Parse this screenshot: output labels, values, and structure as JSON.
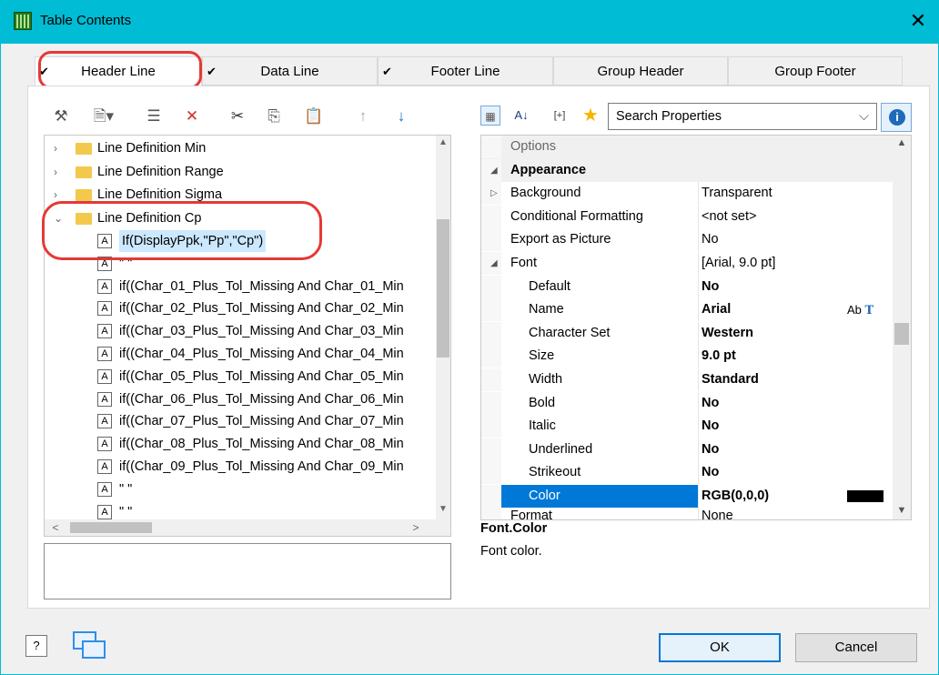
{
  "window": {
    "title": "Table Contents",
    "close_glyph": "✕"
  },
  "tabs": [
    {
      "label": "Header Line",
      "checked": true,
      "active": true
    },
    {
      "label": "Data Line",
      "checked": true,
      "active": false
    },
    {
      "label": "Footer Line",
      "checked": true,
      "active": false
    },
    {
      "label": "Group Header",
      "checked": false,
      "active": false
    },
    {
      "label": "Group Footer",
      "checked": false,
      "active": false
    }
  ],
  "tree_toolbar": {
    "icons": [
      "wand-icon",
      "new-item-dropdown-icon",
      "properties-icon",
      "delete-icon",
      "cut-icon",
      "copy-icon",
      "paste-icon",
      "move-up-icon",
      "move-down-icon"
    ]
  },
  "tree": {
    "folders": [
      {
        "label": "Line Definition Min",
        "expanded": false
      },
      {
        "label": "Line Definition Range",
        "expanded": false
      },
      {
        "label": "Line Definition Sigma",
        "expanded": false
      },
      {
        "label": "Line Definition Cp",
        "expanded": true
      }
    ],
    "items": [
      {
        "label": "If(DisplayPpk,\"Pp\",\"Cp\")",
        "selected": true
      },
      {
        "label": "\" \"",
        "selected": false
      },
      {
        "label": "if((Char_01_Plus_Tol_Missing And Char_01_Min",
        "selected": false
      },
      {
        "label": "if((Char_02_Plus_Tol_Missing And Char_02_Min",
        "selected": false
      },
      {
        "label": "if((Char_03_Plus_Tol_Missing And Char_03_Min",
        "selected": false
      },
      {
        "label": "if((Char_04_Plus_Tol_Missing And Char_04_Min",
        "selected": false
      },
      {
        "label": "if((Char_05_Plus_Tol_Missing And Char_05_Min",
        "selected": false
      },
      {
        "label": "if((Char_06_Plus_Tol_Missing And Char_06_Min",
        "selected": false
      },
      {
        "label": "if((Char_07_Plus_Tol_Missing And Char_07_Min",
        "selected": false
      },
      {
        "label": "if((Char_08_Plus_Tol_Missing And Char_08_Min",
        "selected": false
      },
      {
        "label": "if((Char_09_Plus_Tol_Missing And Char_09_Min",
        "selected": false
      },
      {
        "label": "\" \"",
        "selected": false
      },
      {
        "label": "\" \"",
        "selected": false
      }
    ],
    "item_icon_glyph": "A"
  },
  "properties": {
    "search_placeholder": "Search Properties",
    "toolbar": [
      "categorized-view-icon",
      "sort-alpha-icon",
      "formula-icon",
      "favorites-star-icon"
    ],
    "formula_glyph": "[+]",
    "sort_glyph": "A↓",
    "rows": [
      {
        "name": "Options",
        "value": "",
        "kind": "muted"
      },
      {
        "name": "Appearance",
        "value": "",
        "kind": "group",
        "toggle": "◢"
      },
      {
        "name": "Background",
        "value": "Transparent",
        "kind": "normal",
        "toggle": "▷"
      },
      {
        "name": "Conditional Formatting",
        "value": "<not set>",
        "kind": "normal"
      },
      {
        "name": "Export as Picture",
        "value": "No",
        "kind": "normal"
      },
      {
        "name": "Font",
        "value": "[Arial, 9.0 pt]",
        "kind": "normal",
        "toggle": "◢"
      },
      {
        "name": "Default",
        "value": "No",
        "kind": "sub-bold"
      },
      {
        "name": "Name",
        "value": "Arial",
        "kind": "sub-bold"
      },
      {
        "name": "Character Set",
        "value": "Western",
        "kind": "sub-bold"
      },
      {
        "name": "Size",
        "value": "9.0 pt",
        "kind": "sub-bold"
      },
      {
        "name": "Width",
        "value": "Standard",
        "kind": "sub-bold"
      },
      {
        "name": "Bold",
        "value": "No",
        "kind": "sub-bold"
      },
      {
        "name": "Italic",
        "value": "No",
        "kind": "sub-bold"
      },
      {
        "name": "Underlined",
        "value": "No",
        "kind": "sub-bold"
      },
      {
        "name": "Strikeout",
        "value": "No",
        "kind": "sub-bold"
      },
      {
        "name": "Color",
        "value": "RGB(0,0,0)",
        "kind": "selected"
      },
      {
        "name": "Format",
        "value": "None",
        "kind": "clipped"
      }
    ],
    "font_glyphs": "Ab",
    "color_swatch": "#000000"
  },
  "description": {
    "title": "Font.Color",
    "text": "Font color."
  },
  "footer": {
    "help_glyph": "?",
    "ok_label": "OK",
    "cancel_label": "Cancel"
  },
  "colors": {
    "titlebar": "#00bcd4",
    "annotation": "#e53935",
    "selection": "#0078d7"
  }
}
